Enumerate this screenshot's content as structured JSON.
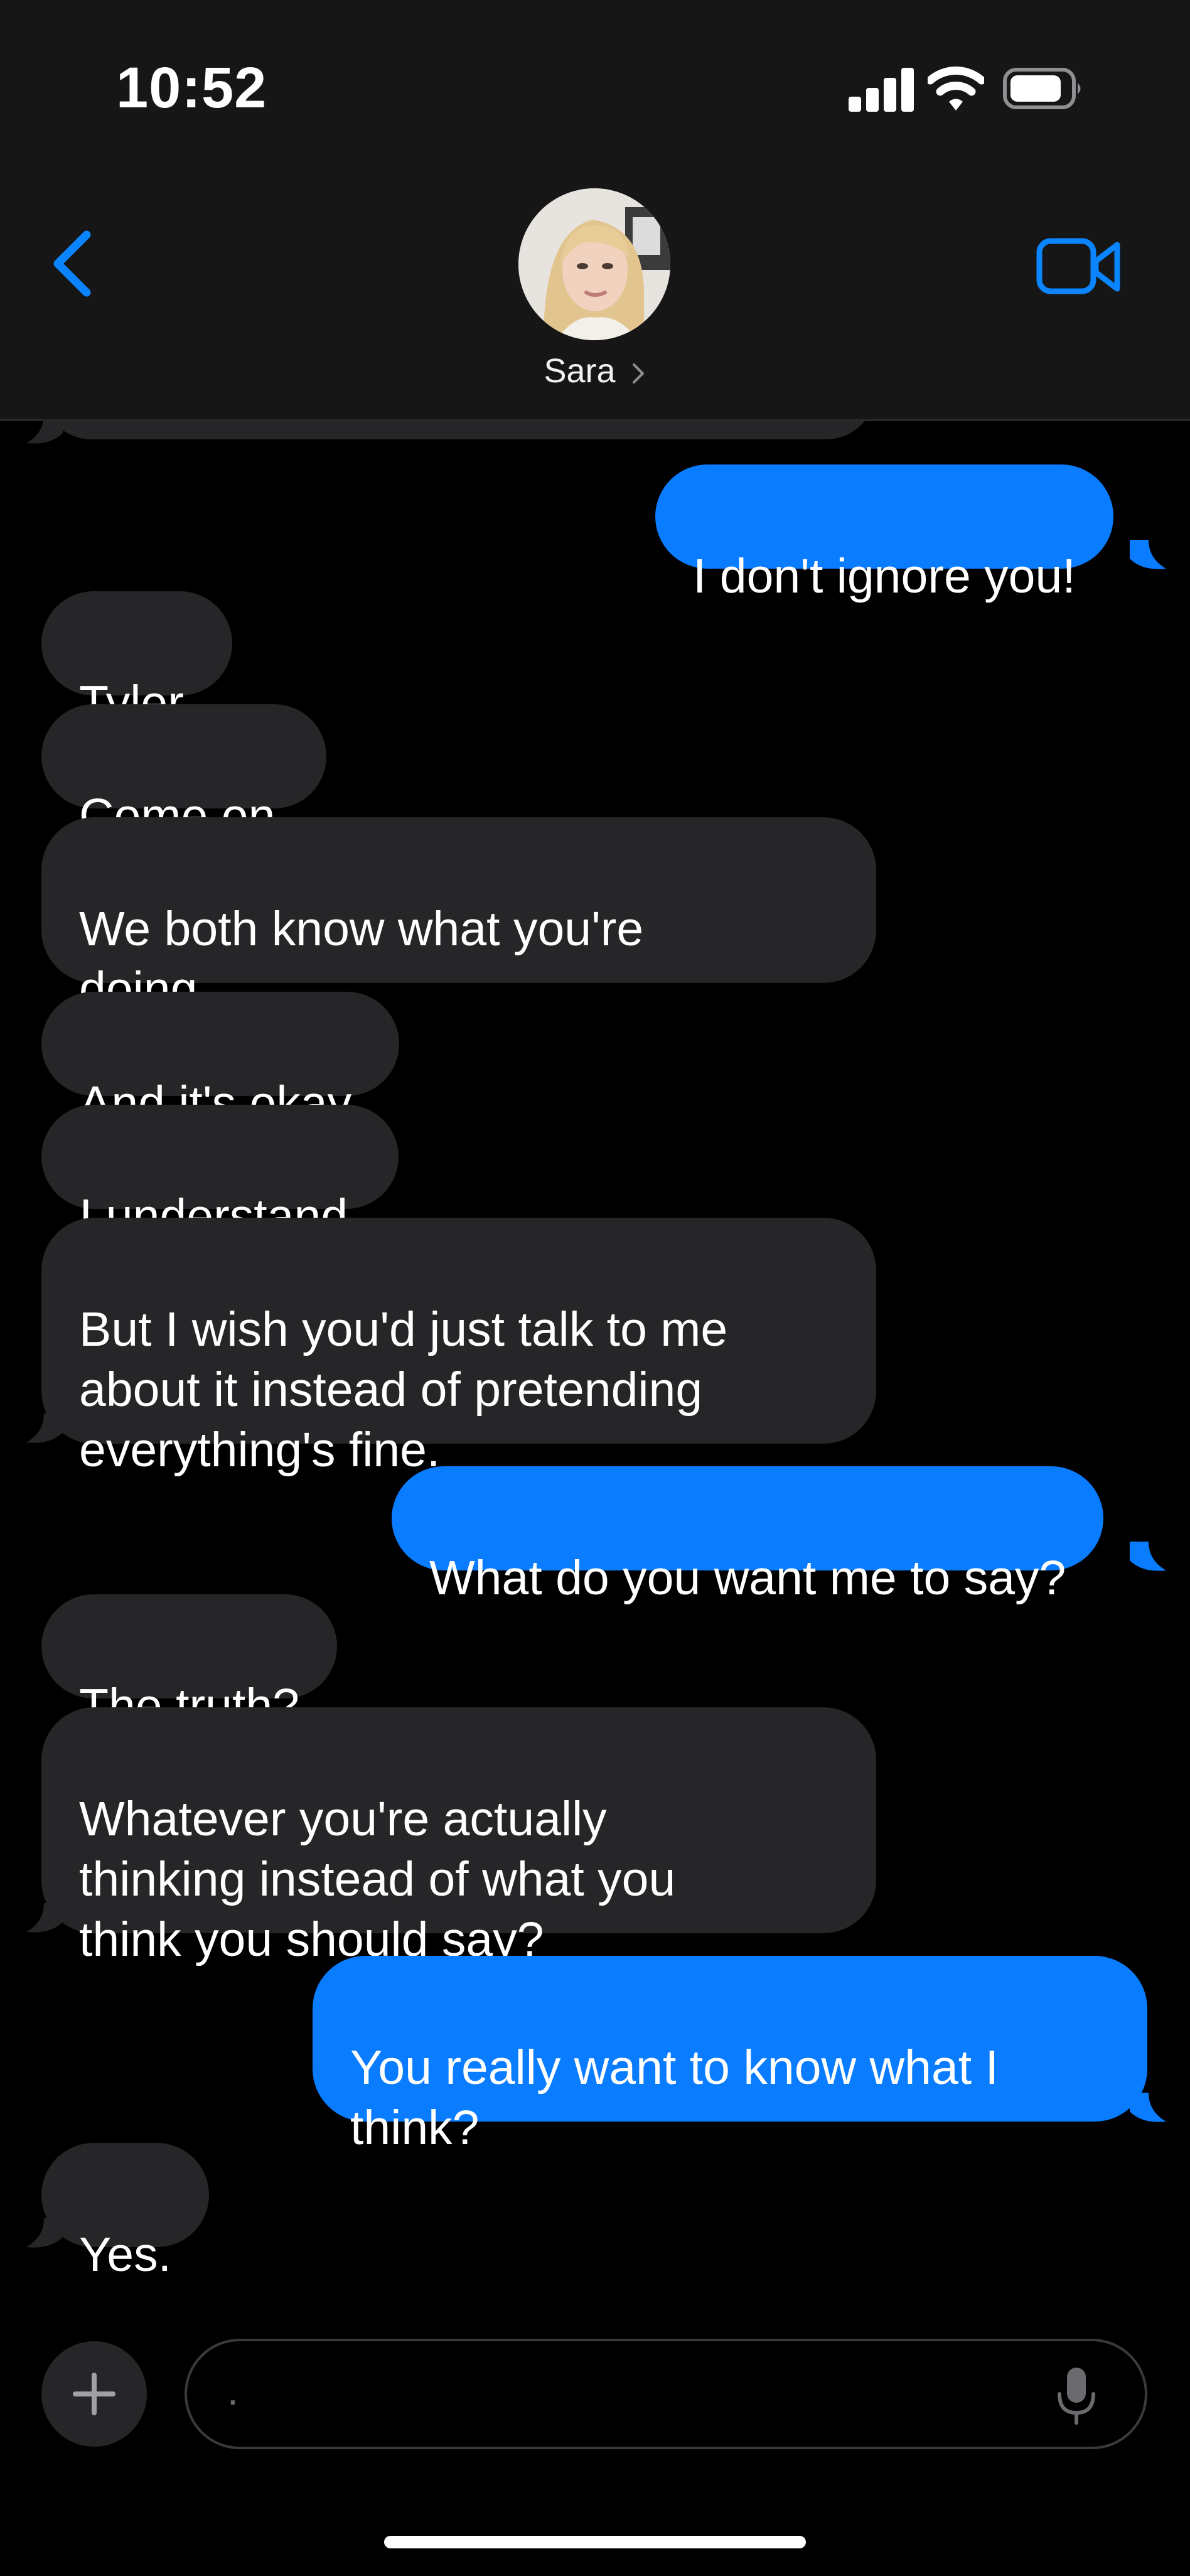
{
  "status_bar": {
    "time": "10:52",
    "icons": [
      "cellular-signal-icon",
      "wifi-icon",
      "battery-icon"
    ]
  },
  "header": {
    "back_icon": "chevron-left-icon",
    "contact_name": "Sara",
    "contact_chevron_icon": "chevron-right-icon",
    "video_icon": "video-camera-icon"
  },
  "conversation": {
    "messages": [
      {
        "from": "me",
        "text": "I don't ignore you!"
      },
      {
        "from": "them",
        "text": "Tyler."
      },
      {
        "from": "them",
        "text": "Come on."
      },
      {
        "from": "them",
        "text": "We both know what you're\ndoing."
      },
      {
        "from": "them",
        "text": "And it's okay."
      },
      {
        "from": "them",
        "text": "I understand."
      },
      {
        "from": "them",
        "text": "But I wish you'd just talk to me\nabout it instead of pretending\neverything's fine."
      },
      {
        "from": "me",
        "text": "What do you want me to say?"
      },
      {
        "from": "them",
        "text": "The truth?"
      },
      {
        "from": "them",
        "text": "Whatever you're actually\nthinking instead of what you\nthink you should say?"
      },
      {
        "from": "me",
        "text": "You really want to know what I\nthink?"
      },
      {
        "from": "them",
        "text": "Yes."
      }
    ]
  },
  "composer": {
    "plus_icon": "plus-icon",
    "placeholder": ".",
    "mic_icon": "microphone-icon"
  },
  "colors": {
    "header_bg": "#161616",
    "received_bubble": "#262628",
    "sent_bubble": "#0a7cff",
    "accent": "#0a84ff",
    "background": "#000000"
  }
}
